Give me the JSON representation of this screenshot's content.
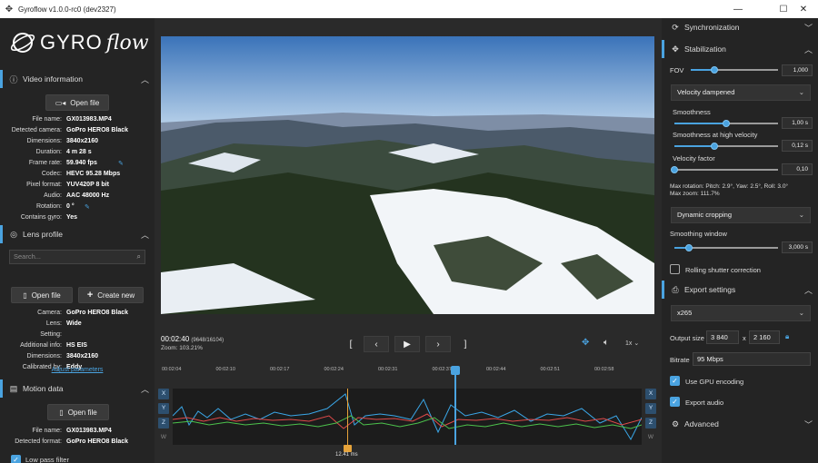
{
  "window": {
    "title": "Gyroflow v1.0.0-rc0 (dev2327)"
  },
  "logo": {
    "part1": "GYRO",
    "part2": "flow"
  },
  "video_info": {
    "header": "Video information",
    "open_file": "Open file",
    "rows": [
      {
        "k": "File name:",
        "v": "GX013983.MP4"
      },
      {
        "k": "Detected camera:",
        "v": "GoPro HERO8 Black"
      },
      {
        "k": "Dimensions:",
        "v": "3840x2160"
      },
      {
        "k": "Duration:",
        "v": "4 m 28 s"
      },
      {
        "k": "Frame rate:",
        "v": "59.940 fps"
      },
      {
        "k": "Codec:",
        "v": "HEVC 95.28 Mbps"
      },
      {
        "k": "Pixel format:",
        "v": "YUV420P 8 bit"
      },
      {
        "k": "Audio:",
        "v": "AAC 48000 Hz"
      },
      {
        "k": "Rotation:",
        "v": "0 °"
      },
      {
        "k": "Contains gyro:",
        "v": "Yes"
      }
    ]
  },
  "lens_profile": {
    "header": "Lens profile",
    "search_placeholder": "Search...",
    "open_file": "Open file",
    "create_new": "Create new",
    "rows": [
      {
        "k": "Camera:",
        "v": "GoPro HERO8 Black"
      },
      {
        "k": "Lens:",
        "v": "Wide"
      },
      {
        "k": "Setting:",
        "v": ""
      },
      {
        "k": "Additional info:",
        "v": "HS EIS"
      },
      {
        "k": "Dimensions:",
        "v": "3840x2160"
      },
      {
        "k": "Calibrated by:",
        "v": "Eddy"
      }
    ],
    "adjust_link": "Adjust parameters"
  },
  "motion_data": {
    "header": "Motion data",
    "open_file": "Open file",
    "rows": [
      {
        "k": "File name:",
        "v": "GX013983.MP4"
      },
      {
        "k": "Detected format:",
        "v": "GoPro HERO8 Black"
      }
    ],
    "low_pass": "Low pass filter"
  },
  "player": {
    "time": "00:02:40",
    "frame": "(9648/16104)",
    "zoom": "Zoom: 103.21%",
    "speed": "1x",
    "playhead_fraction": 0.6,
    "ticks": [
      "00:02:04",
      "00:02:10",
      "00:02:17",
      "00:02:24",
      "00:02:31",
      "00:02:37",
      "00:02:44",
      "00:02:51",
      "00:02:58"
    ],
    "marker_label": "12.41 ms",
    "axes": [
      "X",
      "Y",
      "Z",
      "W"
    ]
  },
  "sync": {
    "header": "Synchronization"
  },
  "stabilization": {
    "header": "Stabilization",
    "fov_label": "FOV",
    "fov_value": "1,000",
    "fov_fraction": 0.27,
    "method": "Velocity dampened",
    "smoothness_label": "Smoothness",
    "smoothness_value": "1,00 s",
    "smoothness_fraction": 0.5,
    "smoothness_high_label": "Smoothness at high velocity",
    "smoothness_high_value": "0,12 s",
    "smoothness_high_fraction": 0.39,
    "velocity_label": "Velocity factor",
    "velocity_value": "0,10",
    "velocity_fraction": 0.0,
    "max_rotation": "Max rotation: Pitch: 2.9°, Yaw: 2.5°, Roll: 3.0°",
    "max_zoom": "Max zoom: 111.7%",
    "cropping": "Dynamic cropping",
    "window_label": "Smoothing window",
    "window_value": "3,000 s",
    "window_fraction": 0.14,
    "rolling_shutter": "Rolling shutter correction"
  },
  "export": {
    "header": "Export settings",
    "codec": "x265",
    "size_label": "Output size",
    "width": "3 840",
    "x": "x",
    "height": "2 160",
    "bitrate_label": "Bitrate",
    "bitrate": "95 Mbps",
    "gpu": "Use GPU encoding",
    "audio": "Export audio"
  },
  "advanced": {
    "header": "Advanced"
  },
  "colors": {
    "accent": "#4aa3e0",
    "panel": "#242424"
  }
}
